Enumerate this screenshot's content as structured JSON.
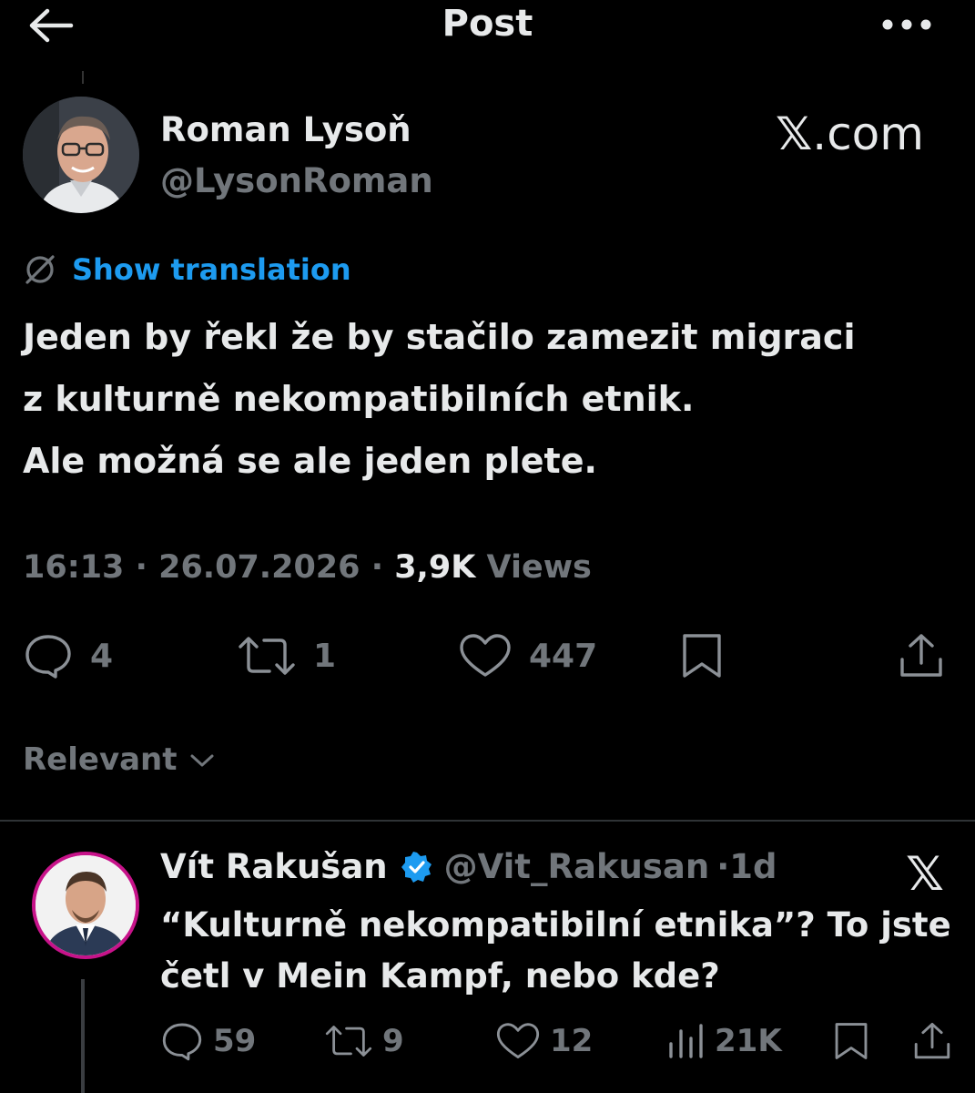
{
  "header": {
    "title": "Post",
    "back_icon": "arrow-left-icon",
    "more_icon": "more-horizontal-icon"
  },
  "post": {
    "author_name": "Roman Lysoň",
    "author_handle": "@LysonRoman",
    "source_label_logo": "𝕏",
    "source_label_text": ".com",
    "translation_label": "Show translation",
    "text": "Jeden by řekl že by stačilo zamezit migraci\nz kulturně nekompatibilních etnik.\nAle možná se ale jeden plete.",
    "time": "16:13",
    "date": "26.07.2026",
    "views_count": "3,9K",
    "views_label": "Views",
    "separator": "·",
    "stats": {
      "replies": "4",
      "reposts": "1",
      "likes": "447"
    }
  },
  "sort": {
    "label": "Relevant"
  },
  "reply": {
    "author_name": "Vít Rakušan",
    "author_handle": "@Vit_Rakusan",
    "time_ago": "1d",
    "separator": "·",
    "text": "“Kulturně nekompatibilní etnika”? To jste četl v Mein Kampf, nebo kde?",
    "source_mark": "𝕏",
    "stats": {
      "replies": "59",
      "reposts": "9",
      "likes": "12",
      "views": "21K"
    }
  },
  "colors": {
    "background": "#000000",
    "text_primary": "#e7e9ea",
    "text_secondary": "#71767b",
    "accent_blue": "#1d9bf0",
    "divider": "#2f3336",
    "avatar_ring": "#c7138a"
  }
}
